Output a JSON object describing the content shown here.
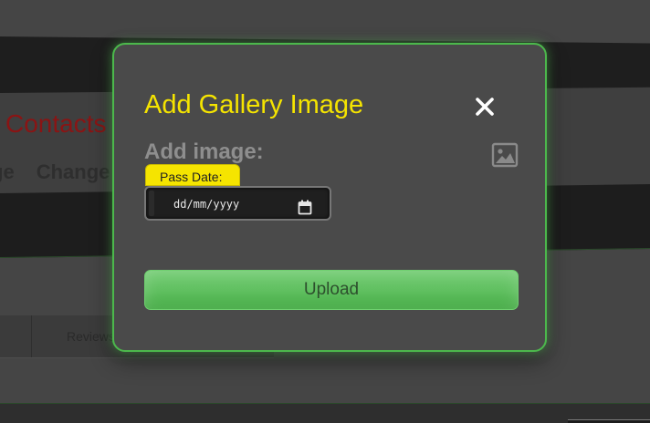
{
  "background": {
    "contacts_title": "Contacts",
    "links": [
      "ge",
      "Change"
    ],
    "tab_reviews": "Reviews"
  },
  "modal": {
    "title": "Add Gallery Image",
    "close_icon": "close-icon",
    "add_image_label": "Add image:",
    "image_icon": "image-icon",
    "pass_date_label": "Pass Date:",
    "date_input": {
      "placeholder": "dd/mm/yyyy",
      "value": ""
    },
    "calendar_icon": "calendar-icon",
    "upload_label": "Upload"
  },
  "colors": {
    "accent_yellow": "#f5e400",
    "accent_green": "#4cb84c",
    "modal_bg": "#4a4a4a",
    "contacts_red": "#8a1414"
  }
}
